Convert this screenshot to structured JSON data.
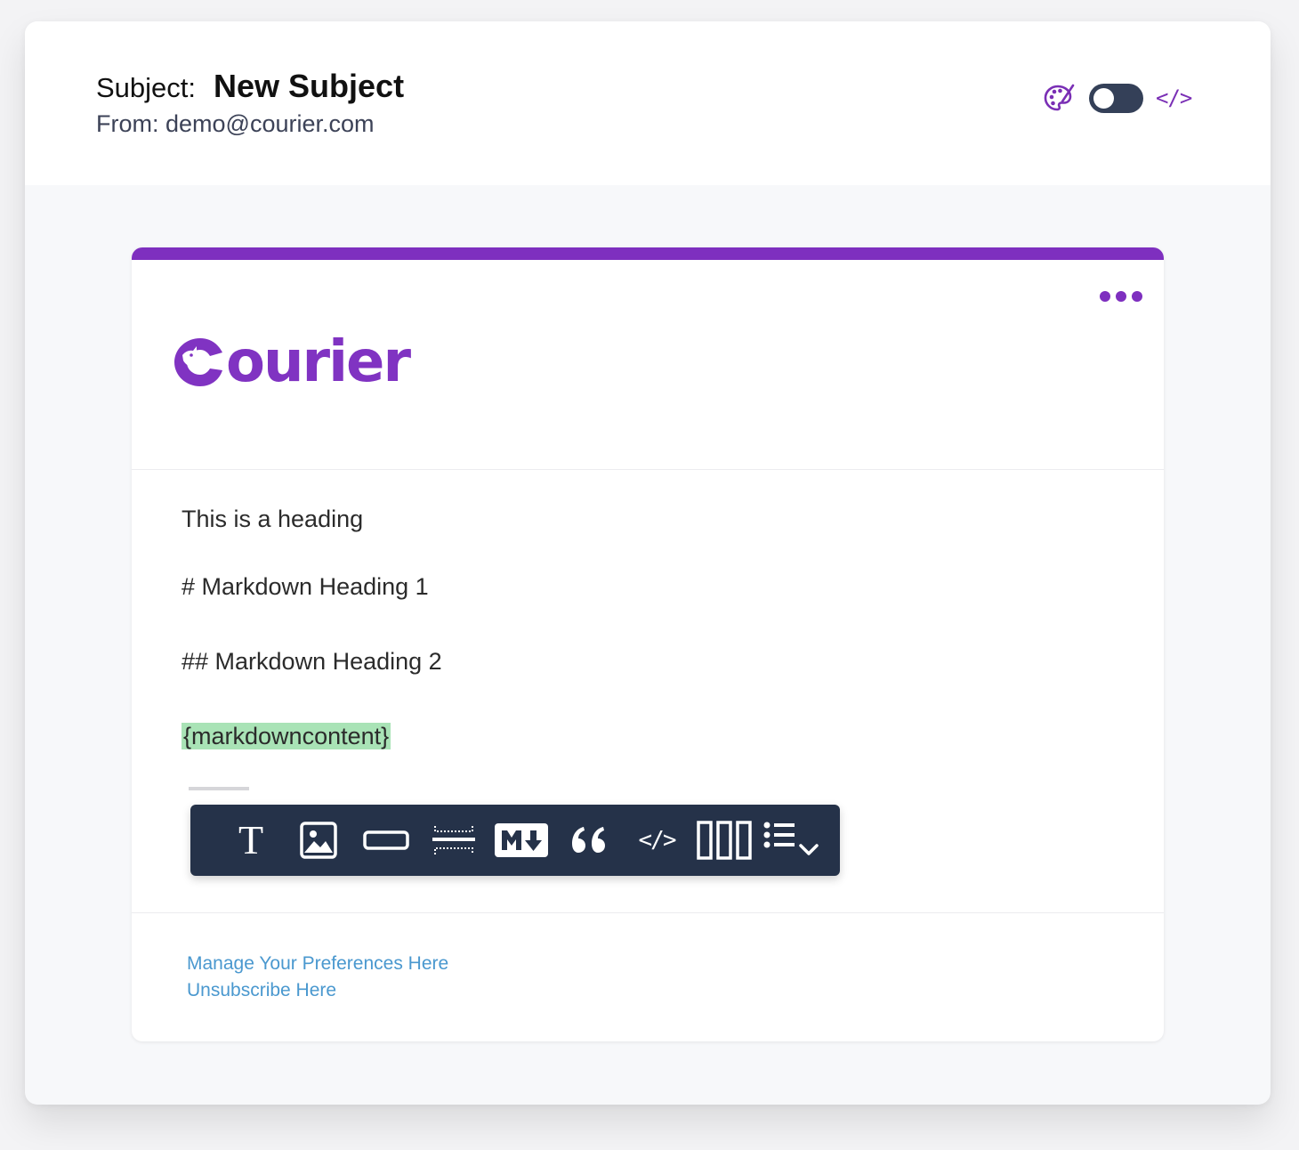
{
  "header": {
    "subject_label": "Subject:",
    "subject_value": "New Subject",
    "from_label": "From:",
    "from_value": "demo@courier.com",
    "tools": {
      "theme_icon": "palette-icon",
      "toggle_state": "off",
      "code_label": "</>"
    }
  },
  "card": {
    "accent_color": "#7e2fbf",
    "logo_text": "Courier",
    "content": {
      "heading": "This is a heading",
      "md_heading_1": "# Markdown Heading 1",
      "md_heading_2": "## Markdown Heading 2",
      "variable": "{markdowncontent}"
    },
    "toolbar": {
      "items": [
        {
          "name": "text-block-icon",
          "label": "T"
        },
        {
          "name": "image-block-icon"
        },
        {
          "name": "action-button-block-icon"
        },
        {
          "name": "divider-block-icon"
        },
        {
          "name": "markdown-block-icon"
        },
        {
          "name": "quote-block-icon"
        },
        {
          "name": "code-block-icon",
          "label": "</>"
        },
        {
          "name": "columns-block-icon"
        },
        {
          "name": "list-block-icon"
        }
      ]
    },
    "footer": {
      "preferences_link": "Manage Your Preferences Here",
      "unsubscribe_link": "Unsubscribe Here"
    }
  }
}
